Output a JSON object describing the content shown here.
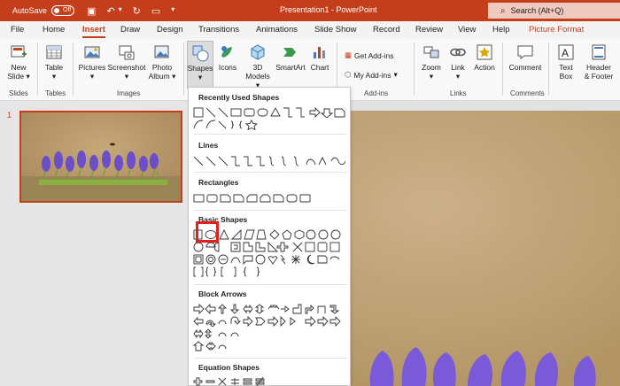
{
  "titlebar": {
    "autosave_label": "AutoSave",
    "autosave_state": "Off",
    "doc_title": "Presentation1  -  PowerPoint",
    "search_placeholder": "Search (Alt+Q)"
  },
  "tabs": [
    "File",
    "Home",
    "Insert",
    "Draw",
    "Design",
    "Transitions",
    "Animations",
    "Slide Show",
    "Record",
    "Review",
    "View",
    "Help",
    "Picture Format"
  ],
  "active_tab": "Insert",
  "ribbon": {
    "new_slide": [
      "New",
      "Slide ▾"
    ],
    "table": [
      "Table",
      "▾"
    ],
    "pictures": [
      "Pictures",
      "▾"
    ],
    "screenshot": [
      "Screenshot",
      "▾"
    ],
    "photo_album": [
      "Photo",
      "Album ▾"
    ],
    "shapes": [
      "Shapes",
      "▾"
    ],
    "icons": [
      "Icons"
    ],
    "models3d": [
      "3D",
      "Models ▾"
    ],
    "smartart": [
      "SmartArt"
    ],
    "chart": [
      "Chart"
    ],
    "get_addins": "Get Add-ins",
    "my_addins": "My Add-ins",
    "zoom": [
      "Zoom",
      "▾"
    ],
    "link": [
      "Link",
      "▾"
    ],
    "action": [
      "Action"
    ],
    "comment": [
      "Comment"
    ],
    "textbox": [
      "Text",
      "Box"
    ],
    "header_footer": [
      "Header",
      "& Footer"
    ],
    "groups": {
      "slides": "Slides",
      "tables": "Tables",
      "images": "Images",
      "addins": "Add-ins",
      "links": "Links",
      "comments": "Comments"
    }
  },
  "thumbnails": {
    "slide_number": "1"
  },
  "shapes_menu": {
    "sections": [
      "Recently Used Shapes",
      "Lines",
      "Rectangles",
      "Basic Shapes",
      "Block Arrows",
      "Equation Shapes"
    ],
    "highlighted_shape": "oval-shape"
  },
  "colors": {
    "accent": "#c43e1c",
    "highlight_box": "#e0201c"
  }
}
